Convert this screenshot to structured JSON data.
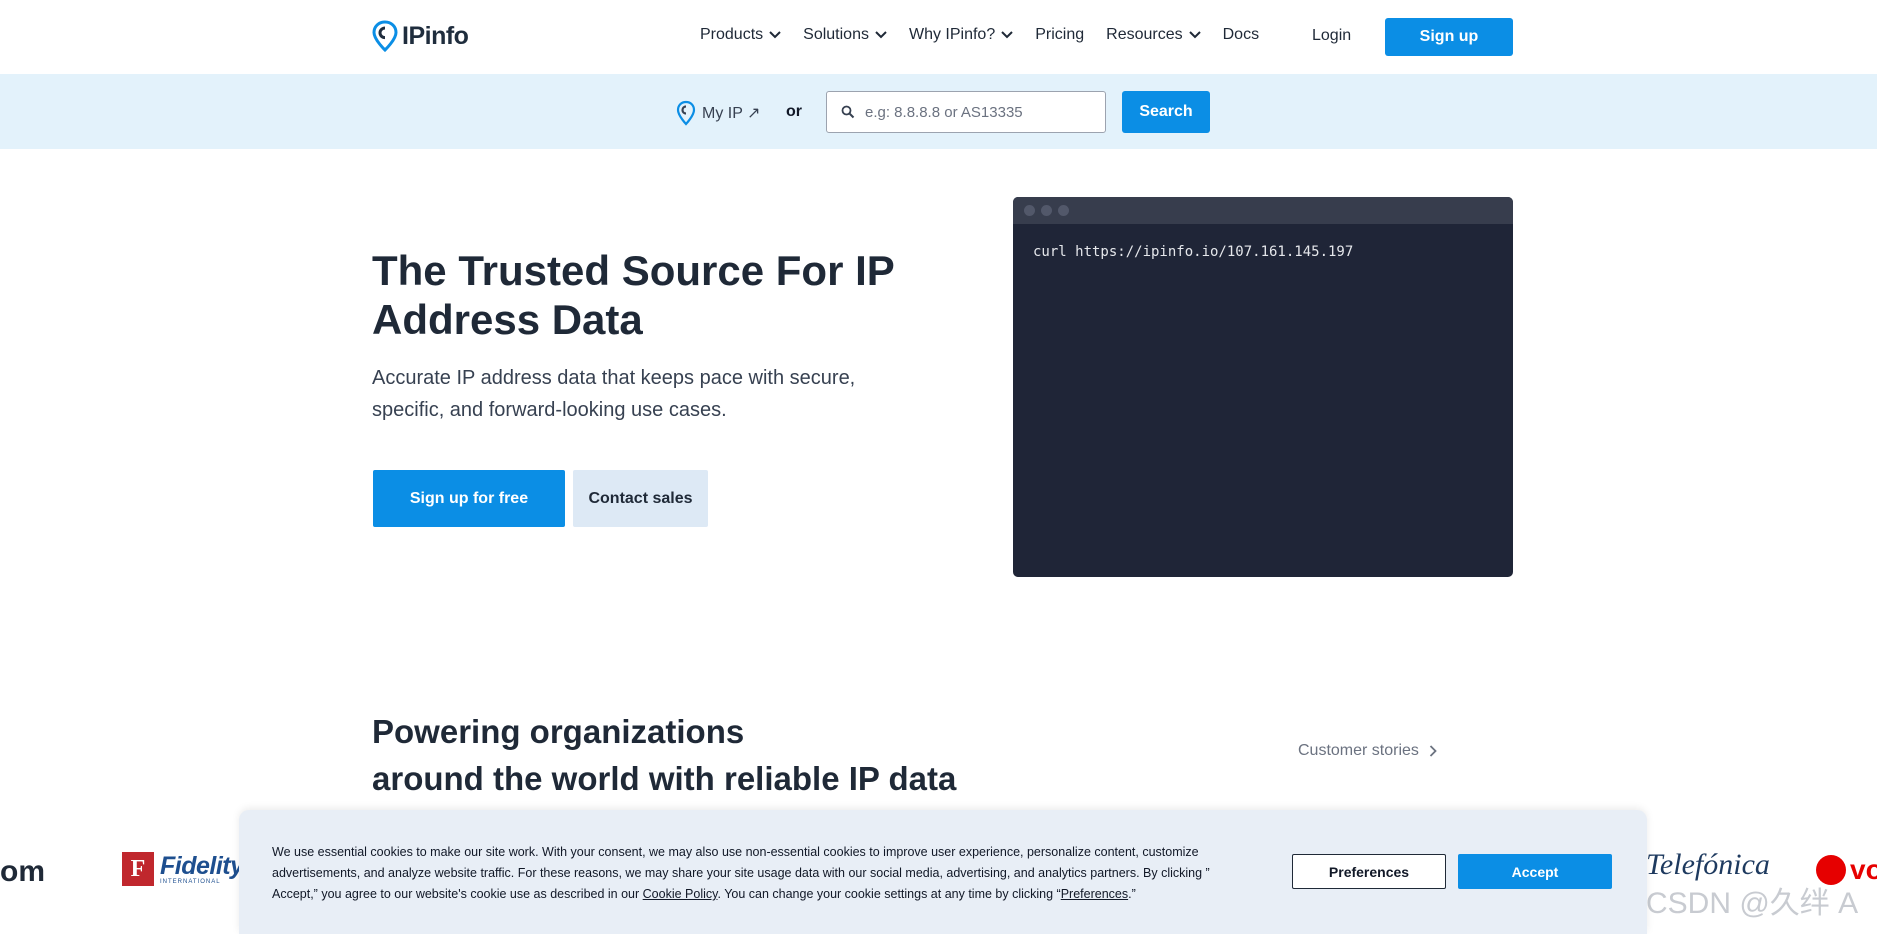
{
  "nav": {
    "logo_text": "IPinfo",
    "menu": [
      {
        "label": "Products",
        "dropdown": true
      },
      {
        "label": "Solutions",
        "dropdown": true
      },
      {
        "label": "Why IPinfo?",
        "dropdown": true
      },
      {
        "label": "Pricing",
        "dropdown": false
      },
      {
        "label": "Resources",
        "dropdown": true
      },
      {
        "label": "Docs",
        "dropdown": false
      }
    ],
    "login": "Login",
    "signup": "Sign up"
  },
  "search": {
    "my_ip": "My IP ↗",
    "or": "or",
    "placeholder": "e.g: 8.8.8.8 or AS13335",
    "button": "Search"
  },
  "hero": {
    "title": "The Trusted Source For IP Address Data",
    "subtitle": "Accurate IP address data that keeps pace with secure, specific, and forward-looking use cases.",
    "primary_cta": "Sign up for free",
    "secondary_cta": "Contact sales"
  },
  "terminal": {
    "command": "curl https://ipinfo.io/107.161.145.197"
  },
  "powering": {
    "title_line1": "Powering organizations",
    "title_line2": "around the world with reliable IP data",
    "customer_stories": "Customer stories"
  },
  "logos": {
    "partial_left": "om",
    "fidelity": "Fidelity",
    "fidelity_sub": "INTERNATIONAL",
    "telefonica": "Telefónica",
    "vodafone_partial": "vo",
    "watermark": "CSDN @久绊 A"
  },
  "cookie": {
    "text_part1": "We use essential cookies to make our site work. With your consent, we may also use non-essential cookies to improve user experience, personalize content, customize advertisements, and analyze website traffic. For these reasons, we may share your site usage data with our social media, advertising, and analytics partners. By clicking ” Accept,” you agree to our website's cookie use as described in our ",
    "cookie_policy": "Cookie Policy",
    "text_part2": ". You can change your cookie settings at any time by clicking “",
    "preferences_link": "Preferences",
    "text_part3": ".”",
    "preferences_button": "Preferences",
    "accept_button": "Accept"
  },
  "colors": {
    "primary": "#0b8ee5",
    "strip_bg": "#e3f2fb",
    "terminal_bg": "#1f2537",
    "cookie_bg": "#e8eef6",
    "text_dark": "#1f2937"
  }
}
